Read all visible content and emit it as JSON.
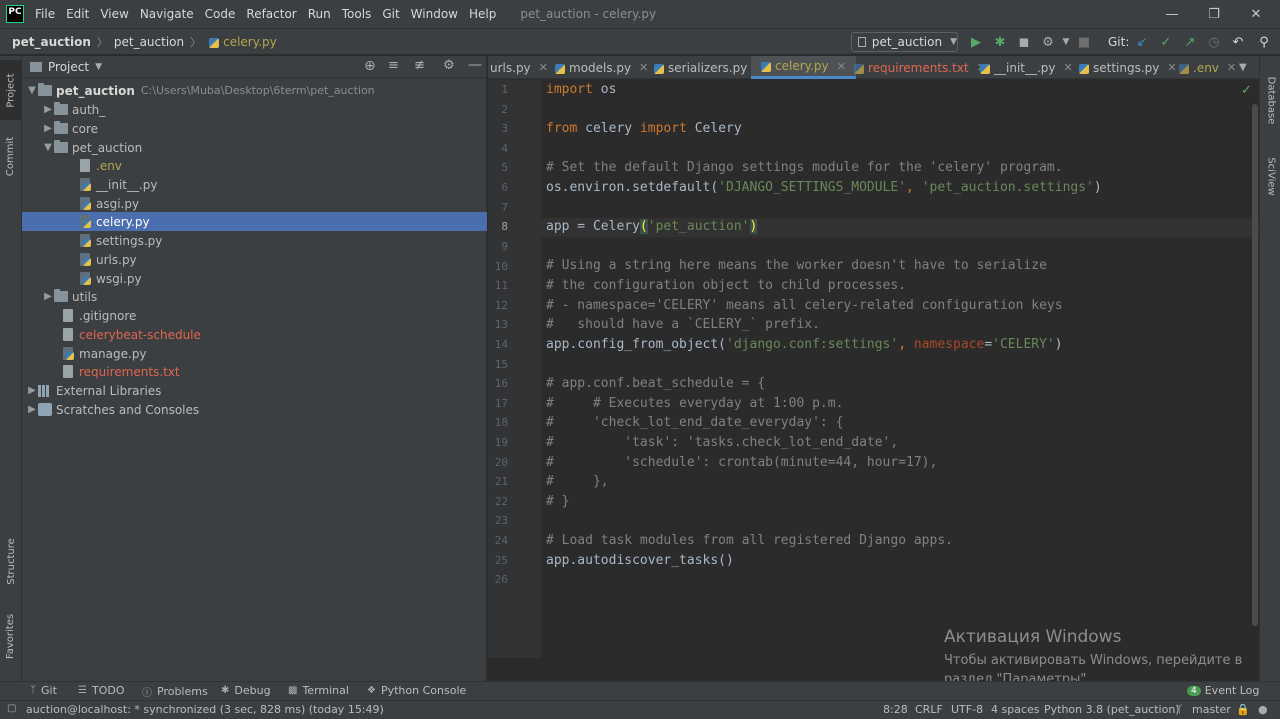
{
  "menubar": {
    "logo": "PC",
    "items": [
      "File",
      "Edit",
      "View",
      "Navigate",
      "Code",
      "Refactor",
      "Run",
      "Tools",
      "Git",
      "Window",
      "Help"
    ],
    "window_title": "pet_auction - celery.py"
  },
  "breadcrumbs": [
    "pet_auction",
    "pet_auction",
    "celery.py"
  ],
  "toolbar": {
    "run_config": "pet_auction",
    "git_label": "Git:"
  },
  "left_strip": {
    "project": "Project",
    "commit": "Commit",
    "structure": "Structure",
    "favorites": "Favorites"
  },
  "right_strip": {
    "database": "Database",
    "sciview": "SciView"
  },
  "project_panel": {
    "title": "Project",
    "tree": {
      "root_name": "pet_auction",
      "root_path": "C:\\Users\\Muba\\Desktop\\6term\\pet_auction",
      "auth": "auth_",
      "core": "core",
      "pet_auction": "pet_auction",
      "env": ".env",
      "init": "__init__.py",
      "asgi": "asgi.py",
      "celery": "celery.py",
      "settings": "settings.py",
      "urls": "urls.py",
      "wsgi": "wsgi.py",
      "utils": "utils",
      "gitignore": ".gitignore",
      "celerybeat": "celerybeat-schedule",
      "manage": "manage.py",
      "requirements": "requirements.txt",
      "external": "External Libraries",
      "scratches": "Scratches and Consoles"
    }
  },
  "editor_tabs": [
    "urls.py",
    "models.py",
    "serializers.py",
    "celery.py",
    "requirements.txt",
    "__init__.py",
    "settings.py",
    ".env"
  ],
  "editor": {
    "current_line": "8",
    "line_numbers": [
      "1",
      "2",
      "3",
      "4",
      "5",
      "6",
      "7",
      "8",
      "9",
      "10",
      "11",
      "12",
      "13",
      "14",
      "15",
      "16",
      "17",
      "18",
      "19",
      "20",
      "21",
      "22",
      "23",
      "24",
      "25",
      "26"
    ],
    "lines": {
      "l1_kw": "import",
      "l1_rest": " os",
      "l3_kw1": "from",
      "l3_mid": " celery ",
      "l3_kw2": "import",
      "l3_rest": " Celery",
      "l5": "# Set the default Django settings module for the 'celery' program.",
      "l6_a": "os.environ.setdefault(",
      "l6_s1": "'DJANGO_SETTINGS_MODULE'",
      "l6_c": ", ",
      "l6_s2": "'pet_auction.settings'",
      "l6_e": ")",
      "l8_a": "app = Celery",
      "l8_p1": "(",
      "l8_s": "'pet_auction'",
      "l8_p2": ")",
      "l10": "# Using a string here means the worker doesn't have to serialize",
      "l11": "# the configuration object to child processes.",
      "l12": "# - namespace='CELERY' means all celery-related configuration keys",
      "l13": "#   should have a `CELERY_` prefix.",
      "l14_a": "app.config_from_object(",
      "l14_s1": "'django.conf:settings'",
      "l14_c": ", ",
      "l14_n": "namespace",
      "l14_eq": "=",
      "l14_s2": "'CELERY'",
      "l14_e": ")",
      "l16": "# app.conf.beat_schedule = {",
      "l17": "#     # Executes everyday at 1:00 p.m.",
      "l18": "#     'check_lot_end_date_everyday': {",
      "l19": "#         'task': 'tasks.check_lot_end_date',",
      "l20": "#         'schedule': crontab(minute=44, hour=17),",
      "l21": "#     },",
      "l22": "# }",
      "l24": "# Load task modules from all registered Django apps.",
      "l25": "app.autodiscover_tasks()"
    }
  },
  "watermark": {
    "title": "Активация Windows",
    "line1": "Чтобы активировать Windows, перейдите в",
    "line2": "раздел \"Параметры\"."
  },
  "bottom_bar": {
    "git": "Git",
    "todo": "TODO",
    "problems": "Problems",
    "debug": "Debug",
    "terminal": "Terminal",
    "python_console": "Python Console",
    "event_log_count": "4",
    "event_log": "Event Log"
  },
  "status_bar": {
    "message": "auction@localhost: * synchronized (3 sec, 828 ms) (today 15:49)",
    "position": "8:28",
    "line_sep": "CRLF",
    "encoding": "UTF-8",
    "indent": "4 spaces",
    "interpreter": "Python 3.8 (pet_auction)",
    "branch": "master"
  },
  "colors": {
    "selection": "#4b6eaf",
    "keyword": "#cc7832",
    "string": "#6a8759",
    "comment": "#808080",
    "modified_file": "#e0664f"
  }
}
